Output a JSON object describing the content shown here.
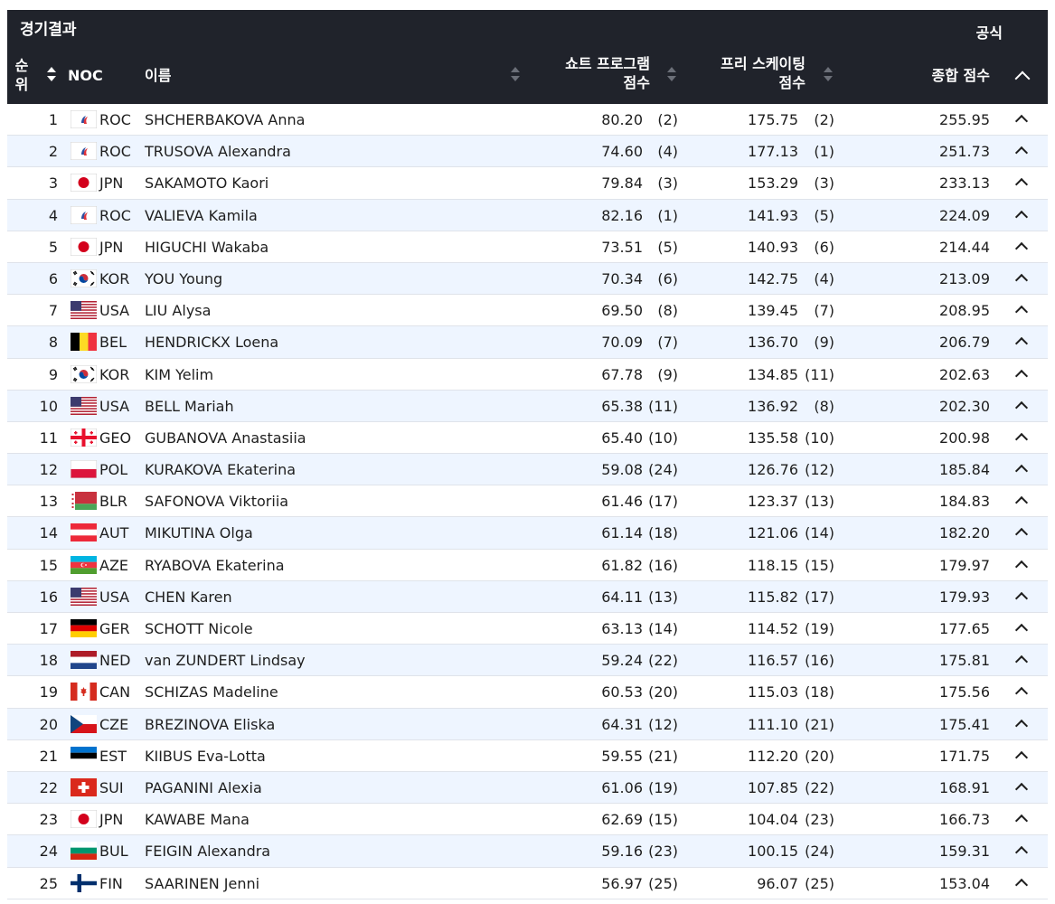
{
  "header": {
    "title": "경기결과",
    "official": "공식",
    "col_rank": "순\n위",
    "col_noc": "NOC",
    "col_name": "이름",
    "col_sp": "쇼트 프로그램\n점수",
    "col_fs": "프리 스케이팅\n점수",
    "col_total": "종합 점수"
  },
  "colors": {
    "header_bg": "#20232b",
    "row_alt_bg": "#eef5ff",
    "divider": "#dfe3ea"
  },
  "rows": [
    {
      "rank": "1",
      "noc": "ROC",
      "flag": "roc",
      "name": "SHCHERBAKOVA Anna",
      "sp": "80.20",
      "sp_rank": "(2)",
      "fs": "175.75",
      "fs_rank": "(2)",
      "total": "255.95"
    },
    {
      "rank": "2",
      "noc": "ROC",
      "flag": "roc",
      "name": "TRUSOVA Alexandra",
      "sp": "74.60",
      "sp_rank": "(4)",
      "fs": "177.13",
      "fs_rank": "(1)",
      "total": "251.73"
    },
    {
      "rank": "3",
      "noc": "JPN",
      "flag": "jpn",
      "name": "SAKAMOTO Kaori",
      "sp": "79.84",
      "sp_rank": "(3)",
      "fs": "153.29",
      "fs_rank": "(3)",
      "total": "233.13"
    },
    {
      "rank": "4",
      "noc": "ROC",
      "flag": "roc",
      "name": "VALIEVA Kamila",
      "sp": "82.16",
      "sp_rank": "(1)",
      "fs": "141.93",
      "fs_rank": "(5)",
      "total": "224.09"
    },
    {
      "rank": "5",
      "noc": "JPN",
      "flag": "jpn",
      "name": "HIGUCHI Wakaba",
      "sp": "73.51",
      "sp_rank": "(5)",
      "fs": "140.93",
      "fs_rank": "(6)",
      "total": "214.44"
    },
    {
      "rank": "6",
      "noc": "KOR",
      "flag": "kor",
      "name": "YOU Young",
      "sp": "70.34",
      "sp_rank": "(6)",
      "fs": "142.75",
      "fs_rank": "(4)",
      "total": "213.09"
    },
    {
      "rank": "7",
      "noc": "USA",
      "flag": "usa",
      "name": "LIU Alysa",
      "sp": "69.50",
      "sp_rank": "(8)",
      "fs": "139.45",
      "fs_rank": "(7)",
      "total": "208.95"
    },
    {
      "rank": "8",
      "noc": "BEL",
      "flag": "bel",
      "name": "HENDRICKX Loena",
      "sp": "70.09",
      "sp_rank": "(7)",
      "fs": "136.70",
      "fs_rank": "(9)",
      "total": "206.79"
    },
    {
      "rank": "9",
      "noc": "KOR",
      "flag": "kor",
      "name": "KIM Yelim",
      "sp": "67.78",
      "sp_rank": "(9)",
      "fs": "134.85",
      "fs_rank": "(11)",
      "total": "202.63"
    },
    {
      "rank": "10",
      "noc": "USA",
      "flag": "usa",
      "name": "BELL Mariah",
      "sp": "65.38",
      "sp_rank": "(11)",
      "fs": "136.92",
      "fs_rank": "(8)",
      "total": "202.30"
    },
    {
      "rank": "11",
      "noc": "GEO",
      "flag": "geo",
      "name": "GUBANOVA Anastasiia",
      "sp": "65.40",
      "sp_rank": "(10)",
      "fs": "135.58",
      "fs_rank": "(10)",
      "total": "200.98"
    },
    {
      "rank": "12",
      "noc": "POL",
      "flag": "pol",
      "name": "KURAKOVA Ekaterina",
      "sp": "59.08",
      "sp_rank": "(24)",
      "fs": "126.76",
      "fs_rank": "(12)",
      "total": "185.84"
    },
    {
      "rank": "13",
      "noc": "BLR",
      "flag": "blr",
      "name": "SAFONOVA Viktoriia",
      "sp": "61.46",
      "sp_rank": "(17)",
      "fs": "123.37",
      "fs_rank": "(13)",
      "total": "184.83"
    },
    {
      "rank": "14",
      "noc": "AUT",
      "flag": "aut",
      "name": "MIKUTINA Olga",
      "sp": "61.14",
      "sp_rank": "(18)",
      "fs": "121.06",
      "fs_rank": "(14)",
      "total": "182.20"
    },
    {
      "rank": "15",
      "noc": "AZE",
      "flag": "aze",
      "name": "RYABOVA Ekaterina",
      "sp": "61.82",
      "sp_rank": "(16)",
      "fs": "118.15",
      "fs_rank": "(15)",
      "total": "179.97"
    },
    {
      "rank": "16",
      "noc": "USA",
      "flag": "usa",
      "name": "CHEN Karen",
      "sp": "64.11",
      "sp_rank": "(13)",
      "fs": "115.82",
      "fs_rank": "(17)",
      "total": "179.93"
    },
    {
      "rank": "17",
      "noc": "GER",
      "flag": "ger",
      "name": "SCHOTT Nicole",
      "sp": "63.13",
      "sp_rank": "(14)",
      "fs": "114.52",
      "fs_rank": "(19)",
      "total": "177.65"
    },
    {
      "rank": "18",
      "noc": "NED",
      "flag": "ned",
      "name": "van ZUNDERT Lindsay",
      "sp": "59.24",
      "sp_rank": "(22)",
      "fs": "116.57",
      "fs_rank": "(16)",
      "total": "175.81"
    },
    {
      "rank": "19",
      "noc": "CAN",
      "flag": "can",
      "name": "SCHIZAS Madeline",
      "sp": "60.53",
      "sp_rank": "(20)",
      "fs": "115.03",
      "fs_rank": "(18)",
      "total": "175.56"
    },
    {
      "rank": "20",
      "noc": "CZE",
      "flag": "cze",
      "name": "BREZINOVA Eliska",
      "sp": "64.31",
      "sp_rank": "(12)",
      "fs": "111.10",
      "fs_rank": "(21)",
      "total": "175.41"
    },
    {
      "rank": "21",
      "noc": "EST",
      "flag": "est",
      "name": "KIIBUS Eva-Lotta",
      "sp": "59.55",
      "sp_rank": "(21)",
      "fs": "112.20",
      "fs_rank": "(20)",
      "total": "171.75"
    },
    {
      "rank": "22",
      "noc": "SUI",
      "flag": "sui",
      "name": "PAGANINI Alexia",
      "sp": "61.06",
      "sp_rank": "(19)",
      "fs": "107.85",
      "fs_rank": "(22)",
      "total": "168.91"
    },
    {
      "rank": "23",
      "noc": "JPN",
      "flag": "jpn",
      "name": "KAWABE Mana",
      "sp": "62.69",
      "sp_rank": "(15)",
      "fs": "104.04",
      "fs_rank": "(23)",
      "total": "166.73"
    },
    {
      "rank": "24",
      "noc": "BUL",
      "flag": "bul",
      "name": "FEIGIN Alexandra",
      "sp": "59.16",
      "sp_rank": "(23)",
      "fs": "100.15",
      "fs_rank": "(24)",
      "total": "159.31"
    },
    {
      "rank": "25",
      "noc": "FIN",
      "flag": "fin",
      "name": "SAARINEN Jenni",
      "sp": "56.97",
      "sp_rank": "(25)",
      "fs": "96.07",
      "fs_rank": "(25)",
      "total": "153.04"
    }
  ]
}
